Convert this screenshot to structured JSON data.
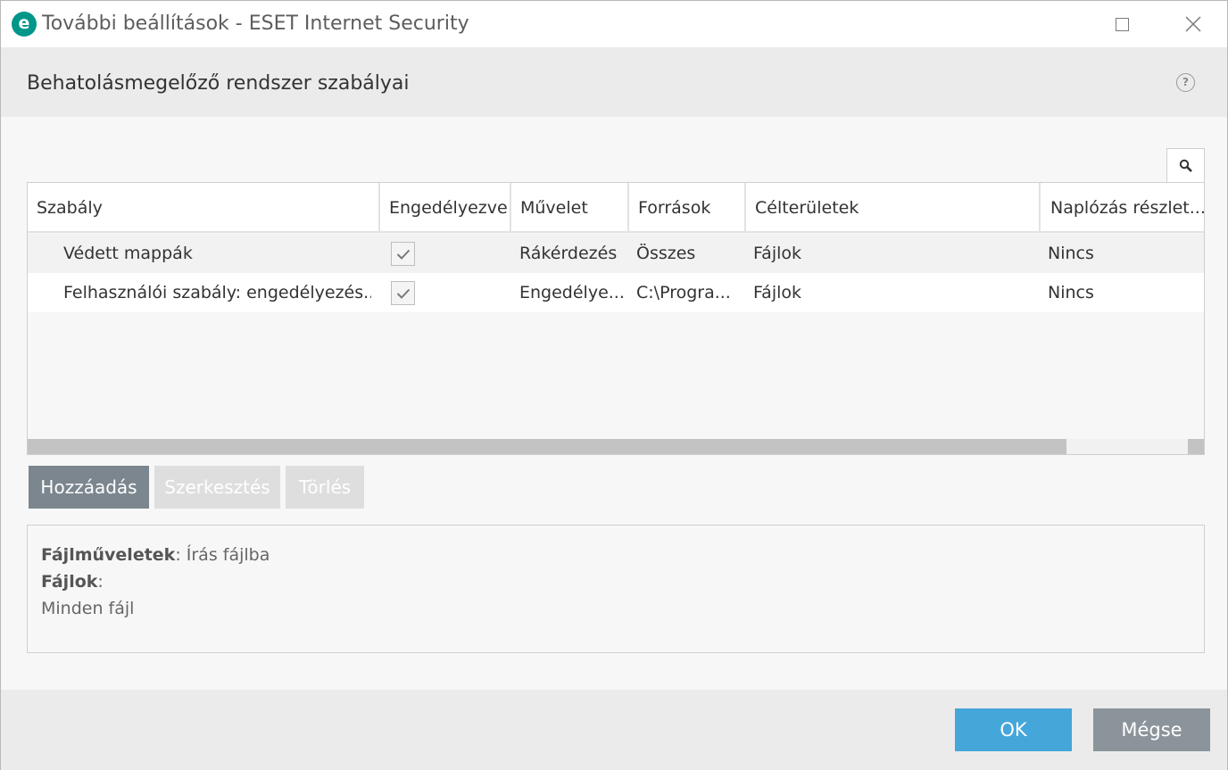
{
  "window": {
    "title": "További beállítások - ESET Internet Security",
    "logo_letter": "e",
    "accent_color": "#00968a"
  },
  "header": {
    "title": "Behatolásmegelőző rendszer szabályai",
    "help_label": "?"
  },
  "table": {
    "columns": [
      "Szabály",
      "Engedélyezve",
      "Művelet",
      "Források",
      "Célterületek",
      "Naplózás részlet..."
    ],
    "rows": [
      {
        "rule": "Védett mappák",
        "enabled": true,
        "action": "Rákérdezés",
        "sources": "Összes",
        "targets": "Fájlok",
        "logging": "Nincs"
      },
      {
        "rule": "Felhasználói szabály: engedélyezés...",
        "enabled": true,
        "action": "Engedélye...",
        "sources": "C:\\Progra...",
        "targets": "Fájlok",
        "logging": "Nincs"
      }
    ]
  },
  "actions": {
    "add": "Hozzáadás",
    "edit": "Szerkesztés",
    "delete": "Törlés"
  },
  "detail": {
    "label1": "Fájlműveletek",
    "sep1": ": ",
    "value1": "Írás fájlba",
    "label2": "Fájlok",
    "sep2": ":",
    "value2": "Minden fájl"
  },
  "footer": {
    "ok": "OK",
    "cancel": "Mégse"
  }
}
